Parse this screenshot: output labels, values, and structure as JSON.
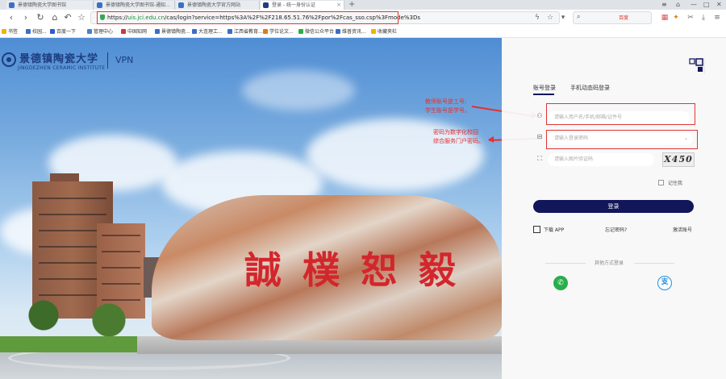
{
  "browser": {
    "tabs": [
      {
        "title": "景德镇陶瓷大学图书馆",
        "active": false
      },
      {
        "title": "景德镇陶瓷大学图书馆-通知...",
        "active": false
      },
      {
        "title": "景德镇陶瓷大学官方网站",
        "active": false
      },
      {
        "title": "登录 - 统一身份认证",
        "active": true
      }
    ],
    "new_tab": "+",
    "url_prefix": "https://",
    "url_host": "uis.jci.edu.cn",
    "url_path": "/cas/login?service=https%3A%2F%2F218.65.51.76%2Fpor%2Fcas_sso.csp%3Fmode%3Ds",
    "search_engine": "百度",
    "bookmarks": [
      {
        "label": "书签",
        "color": "#f0b400"
      },
      {
        "label": "校园...",
        "color": "#3b6ec9"
      },
      {
        "label": "百度一下",
        "color": "#2f5bd8"
      },
      {
        "label": "管理中心",
        "color": "#4a7fd1"
      },
      {
        "label": "中国知网",
        "color": "#c73a3a"
      },
      {
        "label": "景德镇陶瓷...",
        "color": "#3b6ec9"
      },
      {
        "label": "大连理工...",
        "color": "#3b6ec9"
      },
      {
        "label": "江西省教育...",
        "color": "#3b6ec9"
      },
      {
        "label": "学位论文...",
        "color": "#e07b1a"
      },
      {
        "label": "微信公众平台",
        "color": "#2aae4a"
      },
      {
        "label": "维普资讯...",
        "color": "#3b6ec9"
      },
      {
        "label": "收藏夹栏",
        "color": "#f0b400"
      }
    ]
  },
  "header": {
    "school_name_cn": "景德镇陶瓷大学",
    "school_name_en": "JINGDEZHEN CERAMIC INSTITUTE",
    "system_label": "VPN"
  },
  "background": {
    "rock_inscription": "誠樸恕毅"
  },
  "annotations": {
    "account_note_line1": "教师账号是工号;",
    "account_note_line2": "学生账号是学号。",
    "password_note_line1": "密码为数字化校园",
    "password_note_line2": "综合服务门户密码。"
  },
  "login": {
    "tab_account": "账号登录",
    "tab_sms": "手机动态码登录",
    "username_placeholder": "请输入用户名/手机/邮箱/证件号",
    "password_placeholder": "请输入登录密码",
    "captcha_placeholder": "请输入图片验证码",
    "captcha_text": "X450",
    "remember_label": "记住我",
    "login_button": "登录",
    "download_app": "下载 APP",
    "forgot_password": "忘记密码?",
    "activate_account": "激活账号",
    "other_methods": "其他方式登录"
  },
  "colors": {
    "brand_navy": "#12165a",
    "annotation_red": "#e53030",
    "url_green": "#1a8a3a"
  }
}
